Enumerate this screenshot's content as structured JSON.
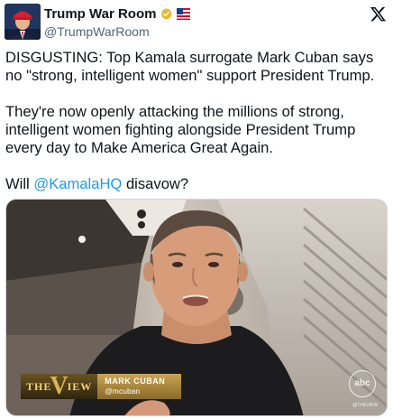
{
  "post": {
    "display_name": "Trump War Room",
    "handle": "@TrumpWarRoom",
    "verified_icon": "gold-verified-badge-icon",
    "affiliate_icon": "american-flag-icon",
    "platform_icon": "x-logo-icon",
    "paragraphs": [
      "DISGUSTING: Top Kamala surrogate Mark Cuban says no \"strong, intelligent women\" support President Trump.",
      "They're now openly attacking the millions of strong, intelligent women fighting alongside President Trump every day to Make America Great Again."
    ],
    "last_line_prefix": "Will ",
    "mention": "@KamalaHQ",
    "last_line_suffix": " disavow?"
  },
  "media": {
    "show_logo_left": "THE",
    "show_logo_v": "V",
    "show_logo_right": "IEW",
    "guest_name": "MARK CUBAN",
    "guest_handle": "@mcuban",
    "network_logo": "abc",
    "network_caption": "@THEVIEW"
  },
  "colors": {
    "link": "#1d9bf0",
    "text": "#0f1419",
    "secondary": "#536471",
    "verified_gold": "#e8b829"
  }
}
